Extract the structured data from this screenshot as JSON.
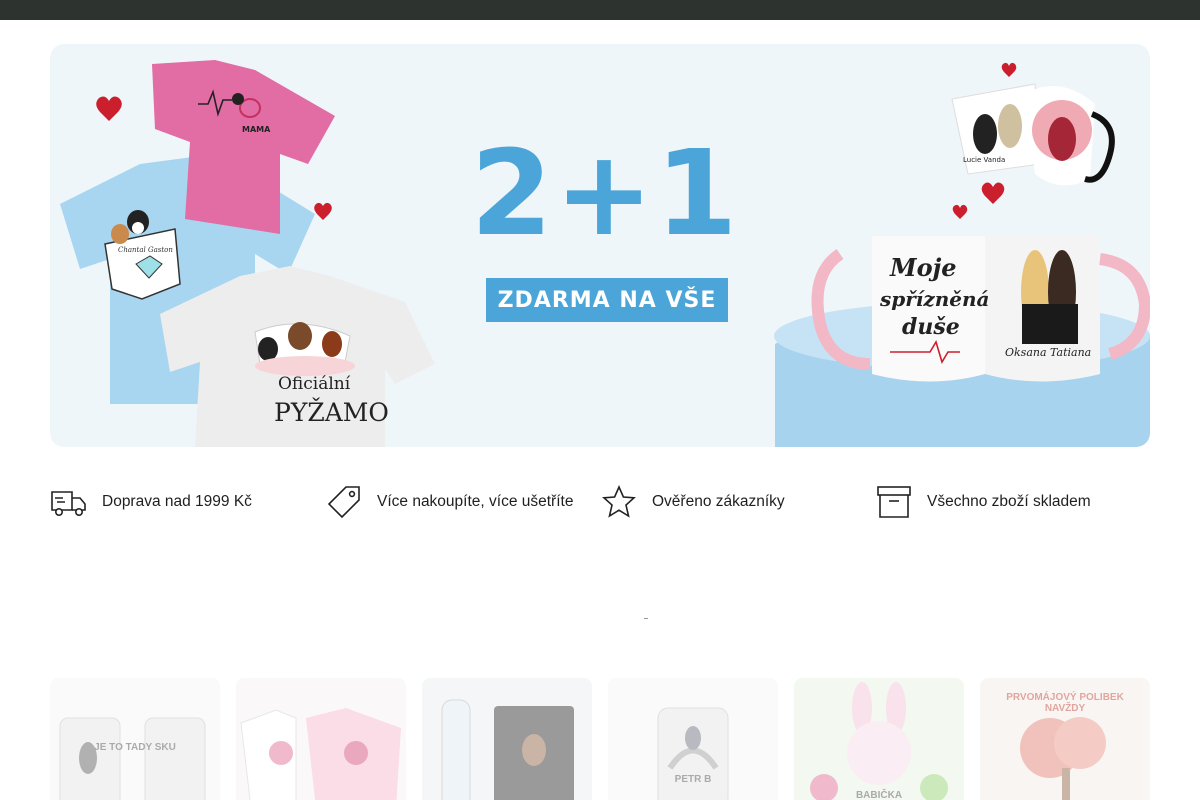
{
  "colors": {
    "topbar": "#2d3430",
    "promo_blue": "#4ca5d8",
    "hero_bg": "#eef6fa"
  },
  "hero": {
    "promo_number": "2+1",
    "promo_text": "ZDARMA NA VŠE",
    "tshirt_pocket_names": "Chantal Gaston",
    "pyjama_line1": "Oficiální",
    "pyjama_line2": "PYŽAMO",
    "pink_tee_text": "MAMA",
    "mug_text_line1": "Moje",
    "mug_text_line2": "spřízněná",
    "mug_text_line3": "duše",
    "mug_names": "Oksana  Tatiana",
    "small_mug_names": "Lucie  Vanda"
  },
  "features": [
    {
      "icon": "delivery-truck-icon",
      "label": "Doprava nad 1999 Kč"
    },
    {
      "icon": "price-tag-icon",
      "label": "Více nakoupíte, více ušetříte"
    },
    {
      "icon": "star-icon",
      "label": "Ověřeno zákazníky"
    },
    {
      "icon": "archive-box-icon",
      "label": "Všechno zboží skladem"
    }
  ],
  "products": [
    {
      "icon": "tumbler-icon",
      "text": "JE TO TADY SKU"
    },
    {
      "icon": "tshirt-icon",
      "text": ""
    },
    {
      "icon": "bottle-notebook-icon",
      "text": ""
    },
    {
      "icon": "tumbler-icon",
      "text": "PETR B"
    },
    {
      "icon": "easter-bunny-icon",
      "text": "BABIČKA"
    },
    {
      "icon": "tree-icon",
      "text": "PRVOMÁJOVÝ POLIBEK NAVŽDY"
    }
  ]
}
